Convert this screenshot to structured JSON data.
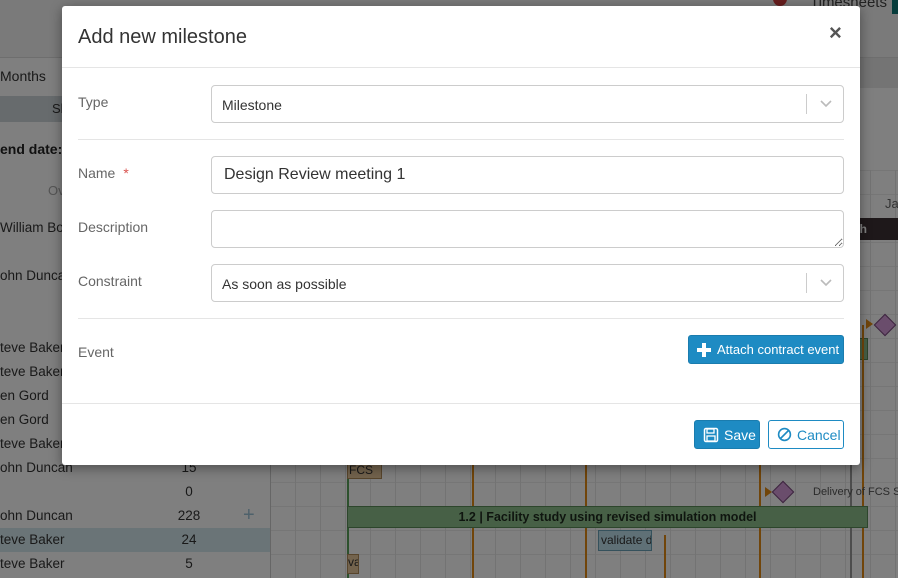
{
  "background": {
    "header_link": "Timesheets",
    "view_label": "Months",
    "short_button": "Sh",
    "end_date_label": "end date:",
    "overview_header": "Ov",
    "month_label": "Ja",
    "dark_bar_text": "sh",
    "rows": [
      {
        "who": "William Bold",
        "num": ""
      },
      {
        "who": "ohn Duncan",
        "num": ""
      },
      {
        "who": "",
        "num": ""
      },
      {
        "who": "teve Baker",
        "num": ""
      },
      {
        "who": "teve Baker",
        "num": ""
      },
      {
        "who": "en Gord",
        "num": ""
      },
      {
        "who": "en Gord",
        "num": ""
      },
      {
        "who": "teve Baker",
        "num": ""
      },
      {
        "who": "ohn Duncan",
        "num": "15"
      },
      {
        "who": "",
        "num": "0"
      },
      {
        "who": "ohn Duncan",
        "num": "228"
      },
      {
        "who": "teve Baker",
        "num": "24"
      },
      {
        "who": "teve Baker",
        "num": "5"
      }
    ],
    "gantt": {
      "task_short": "FCS s",
      "deliverable": "Delivery of FCS S",
      "main_task": "1.2 | Facility study using revised simulation model",
      "validate": "validate d",
      "va": "va"
    }
  },
  "modal": {
    "title": "Add new milestone",
    "close_glyph": "×",
    "type_label": "Type",
    "type_value": "Milestone",
    "name_label": "Name",
    "required_mark": "*",
    "name_value": "Design Review meeting 1",
    "description_label": "Description",
    "description_value": "",
    "constraint_label": "Constraint",
    "constraint_value": "As soon as possible",
    "event_label": "Event",
    "attach_button": "Attach contract event",
    "save_button": "Save",
    "cancel_button": "Cancel"
  },
  "colors": {
    "primary": "#1e8bc3",
    "task_bar": "#8fc08d",
    "milestone": "#d49bd8",
    "dependency": "#e38b14",
    "required": "#d9534f"
  }
}
